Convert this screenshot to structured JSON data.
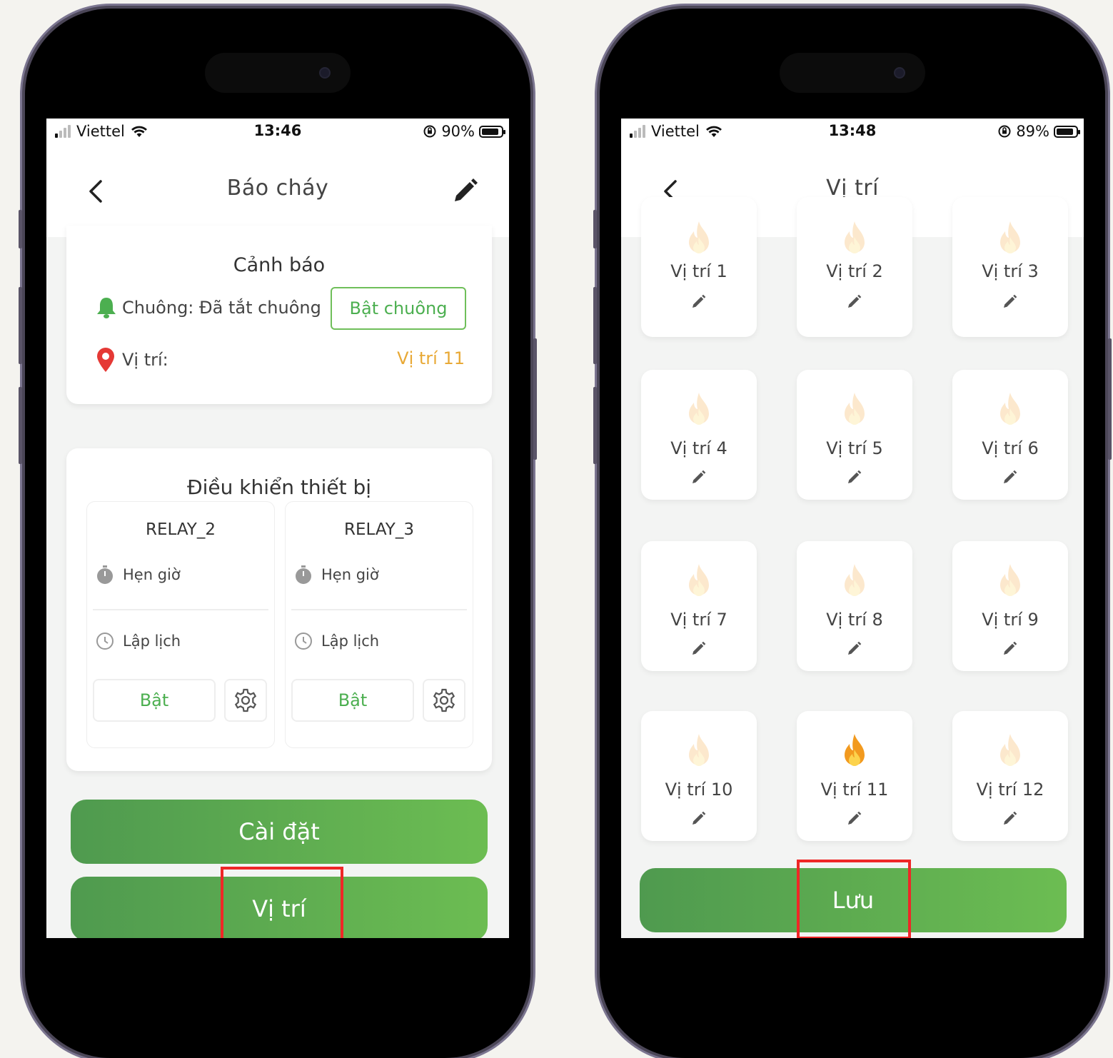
{
  "colors": {
    "accent_green": "#4caf50",
    "warning_orange": "#e8a936",
    "highlight_red": "#ef2727"
  },
  "left_screen": {
    "status": {
      "carrier": "Viettel",
      "time": "13:46",
      "battery": "90%",
      "battery_level": 0.9
    },
    "nav": {
      "title": "Báo cháy"
    },
    "alert": {
      "title": "Cảnh báo",
      "bell_label": "Chuông: Đã tắt chuông",
      "bell_button": "Bật chuông",
      "location_label": "Vị trí:",
      "location_value": "Vị trí 11"
    },
    "control": {
      "title": "Điều khiển thiết bị",
      "relays": [
        {
          "name": "RELAY_2",
          "timer_label": "Hẹn giờ",
          "schedule_label": "Lập lịch",
          "on_label": "Bật"
        },
        {
          "name": "RELAY_3",
          "timer_label": "Hẹn giờ",
          "schedule_label": "Lập lịch",
          "on_label": "Bật"
        }
      ]
    },
    "buttons": {
      "settings": "Cài đặt",
      "location": "Vị trí"
    }
  },
  "right_screen": {
    "status": {
      "carrier": "Viettel",
      "time": "13:48",
      "battery": "89%",
      "battery_level": 0.89
    },
    "nav": {
      "title": "Vị trí"
    },
    "locations": [
      {
        "label": "Vị trí 1",
        "active": false
      },
      {
        "label": "Vị trí 2",
        "active": false
      },
      {
        "label": "Vị trí 3",
        "active": false
      },
      {
        "label": "Vị trí 4",
        "active": false
      },
      {
        "label": "Vị trí 5",
        "active": false
      },
      {
        "label": "Vị trí 6",
        "active": false
      },
      {
        "label": "Vị trí 7",
        "active": false
      },
      {
        "label": "Vị trí 8",
        "active": false
      },
      {
        "label": "Vị trí 9",
        "active": false
      },
      {
        "label": "Vị trí 10",
        "active": false
      },
      {
        "label": "Vị trí 11",
        "active": true
      },
      {
        "label": "Vị trí 12",
        "active": false
      }
    ],
    "save_button": "Lưu"
  }
}
